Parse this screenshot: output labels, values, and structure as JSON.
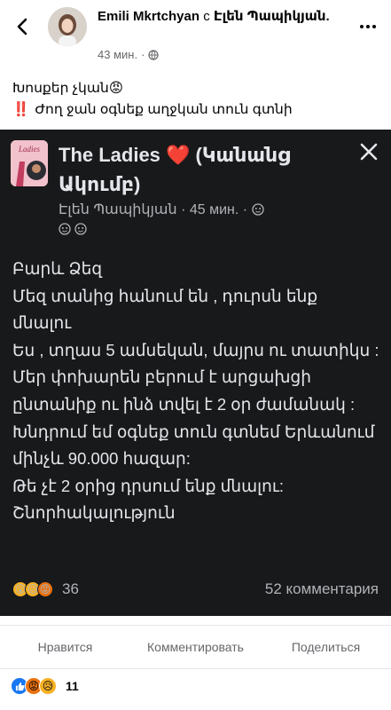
{
  "header": {
    "author": "Emili Mkrtchyan",
    "with_word": "с",
    "tagged": "Էլեն Պապիկյան.",
    "time": "43 мин.",
    "dot": "·"
  },
  "post": {
    "line1": "Խոսքեր չկան😡",
    "line2_mark": "‼️",
    "line2": "Ժող ջան օգնեք աղջկան տուն գտնի"
  },
  "card": {
    "title": "The Ladies ❤️ (Կանանց Ակումբ)",
    "author": "Էլեն Պապիկյան",
    "time": "45 мин.",
    "dot": "·",
    "body_lines": [
      "Բարև Ձեզ",
      "Մեզ տանից հանում են , դուրսն ենք մնալու",
      "Ես , տղաս 5 ամսեկան, մայրս ու տատիկս : Մեր փոխարեն բերում է արցախցի ընտանիք ու ինձ տվել է 2 օր ժամանակ :",
      "Խնդրում եմ օգնեք տուն գտնեմ Երևանում մինչև 90.000 հազար:",
      "Թե չէ 2 օրից դրսում ենք մնալու:",
      "Շնորհակալություն"
    ],
    "reaction_count": "36",
    "comments": "52 комментария"
  },
  "actions": {
    "like": "Нравится",
    "comment": "Комментировать",
    "share": "Поделиться"
  },
  "footer": {
    "reaction_count": "11"
  },
  "colors": {
    "card_bg": "#18191a",
    "like_blue": "#1877f2",
    "angry_orange": "#e9710f",
    "sad_yellow": "#f7b125"
  },
  "icons": [
    "back-arrow-icon",
    "more-icon",
    "globe-icon",
    "close-icon",
    "like-icon",
    "angry-icon",
    "sad-icon",
    "wow-icon"
  ]
}
